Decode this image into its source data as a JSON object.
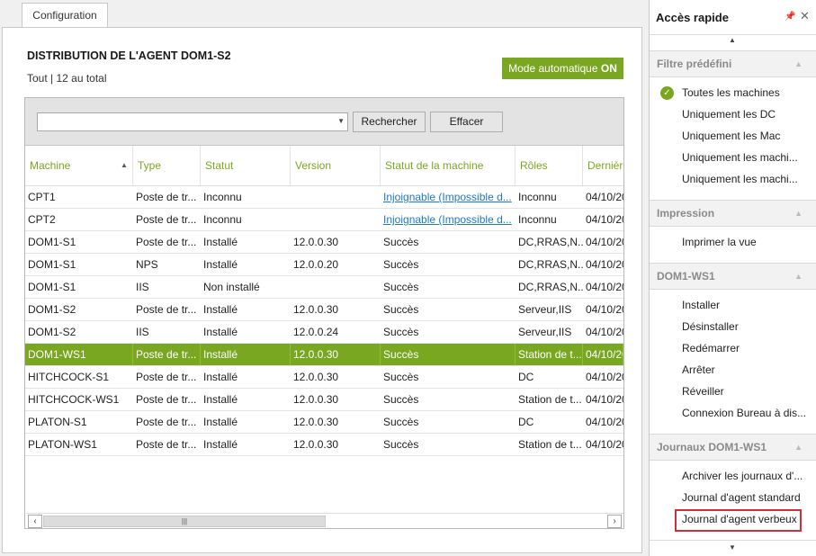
{
  "tab": {
    "label": "Configuration"
  },
  "header": {
    "title": "DISTRIBUTION DE L'AGENT  DOM1-S2",
    "subtitle": "Tout | 12 au total",
    "auto_mode_label": "Mode automatique",
    "auto_mode_state": "ON"
  },
  "search": {
    "value": "",
    "search_button": "Rechercher",
    "clear_button": "Effacer"
  },
  "table": {
    "columns": [
      "Machine",
      "Type",
      "Statut",
      "Version",
      "Statut de la machine",
      "Rôles",
      "Dernière"
    ],
    "sorted_column": "Machine",
    "sort_direction": "ascending",
    "rows": [
      [
        "CPT1",
        "Poste de tr...",
        "Inconnu",
        "",
        "Injoignable (Impossible d...",
        "Inconnu",
        "04/10/20"
      ],
      [
        "CPT2",
        "Poste de tr...",
        "Inconnu",
        "",
        "Injoignable (Impossible d...",
        "Inconnu",
        "04/10/20"
      ],
      [
        "DOM1-S1",
        "Poste de tr...",
        "Installé",
        "12.0.0.30",
        "Succès",
        "DC,RRAS,N...",
        "04/10/20"
      ],
      [
        "DOM1-S1",
        "NPS",
        "Installé",
        "12.0.0.20",
        "Succès",
        "DC,RRAS,N...",
        "04/10/20"
      ],
      [
        "DOM1-S1",
        "IIS",
        "Non installé",
        "",
        "Succès",
        "DC,RRAS,N...",
        "04/10/20"
      ],
      [
        "DOM1-S2",
        "Poste de tr...",
        "Installé",
        "12.0.0.30",
        "Succès",
        "Serveur,IIS",
        "04/10/20"
      ],
      [
        "DOM1-S2",
        "IIS",
        "Installé",
        "12.0.0.24",
        "Succès",
        "Serveur,IIS",
        "04/10/20"
      ],
      [
        "DOM1-WS1",
        "Poste de tr...",
        "Installé",
        "12.0.0.30",
        "Succès",
        "Station de t...",
        "04/10/20"
      ],
      [
        "HITCHCOCK-S1",
        "Poste de tr...",
        "Installé",
        "12.0.0.30",
        "Succès",
        "DC",
        "04/10/20"
      ],
      [
        "HITCHCOCK-WS1",
        "Poste de tr...",
        "Installé",
        "12.0.0.30",
        "Succès",
        "Station de t...",
        "04/10/20"
      ],
      [
        "PLATON-S1",
        "Poste de tr...",
        "Installé",
        "12.0.0.30",
        "Succès",
        "DC",
        "04/10/20"
      ],
      [
        "PLATON-WS1",
        "Poste de tr...",
        "Installé",
        "12.0.0.30",
        "Succès",
        "Station de t...",
        "04/10/20"
      ]
    ],
    "selected_row": 7
  },
  "quick_access": {
    "title": "Accès rapide",
    "sections": [
      {
        "title": "Filtre prédéfini",
        "items": [
          "Toutes les machines",
          "Uniquement les DC",
          "Uniquement les Mac",
          "Uniquement les machi...",
          "Uniquement les machi..."
        ]
      },
      {
        "title": "Impression",
        "items": [
          "Imprimer la vue"
        ]
      },
      {
        "title": "DOM1-WS1",
        "items": [
          "Installer",
          "Désinstaller",
          "Redémarrer",
          "Arrêter",
          "Réveiller",
          "Connexion Bureau à dis..."
        ]
      },
      {
        "title": "Journaux DOM1-WS1",
        "items": [
          "Archiver les journaux d'...",
          "Journal d'agent standard",
          "Journal d'agent verbeux"
        ]
      }
    ]
  },
  "colors": {
    "accent": "#7aa721",
    "link": "#1e78c8",
    "highlight": "#d0303a"
  }
}
